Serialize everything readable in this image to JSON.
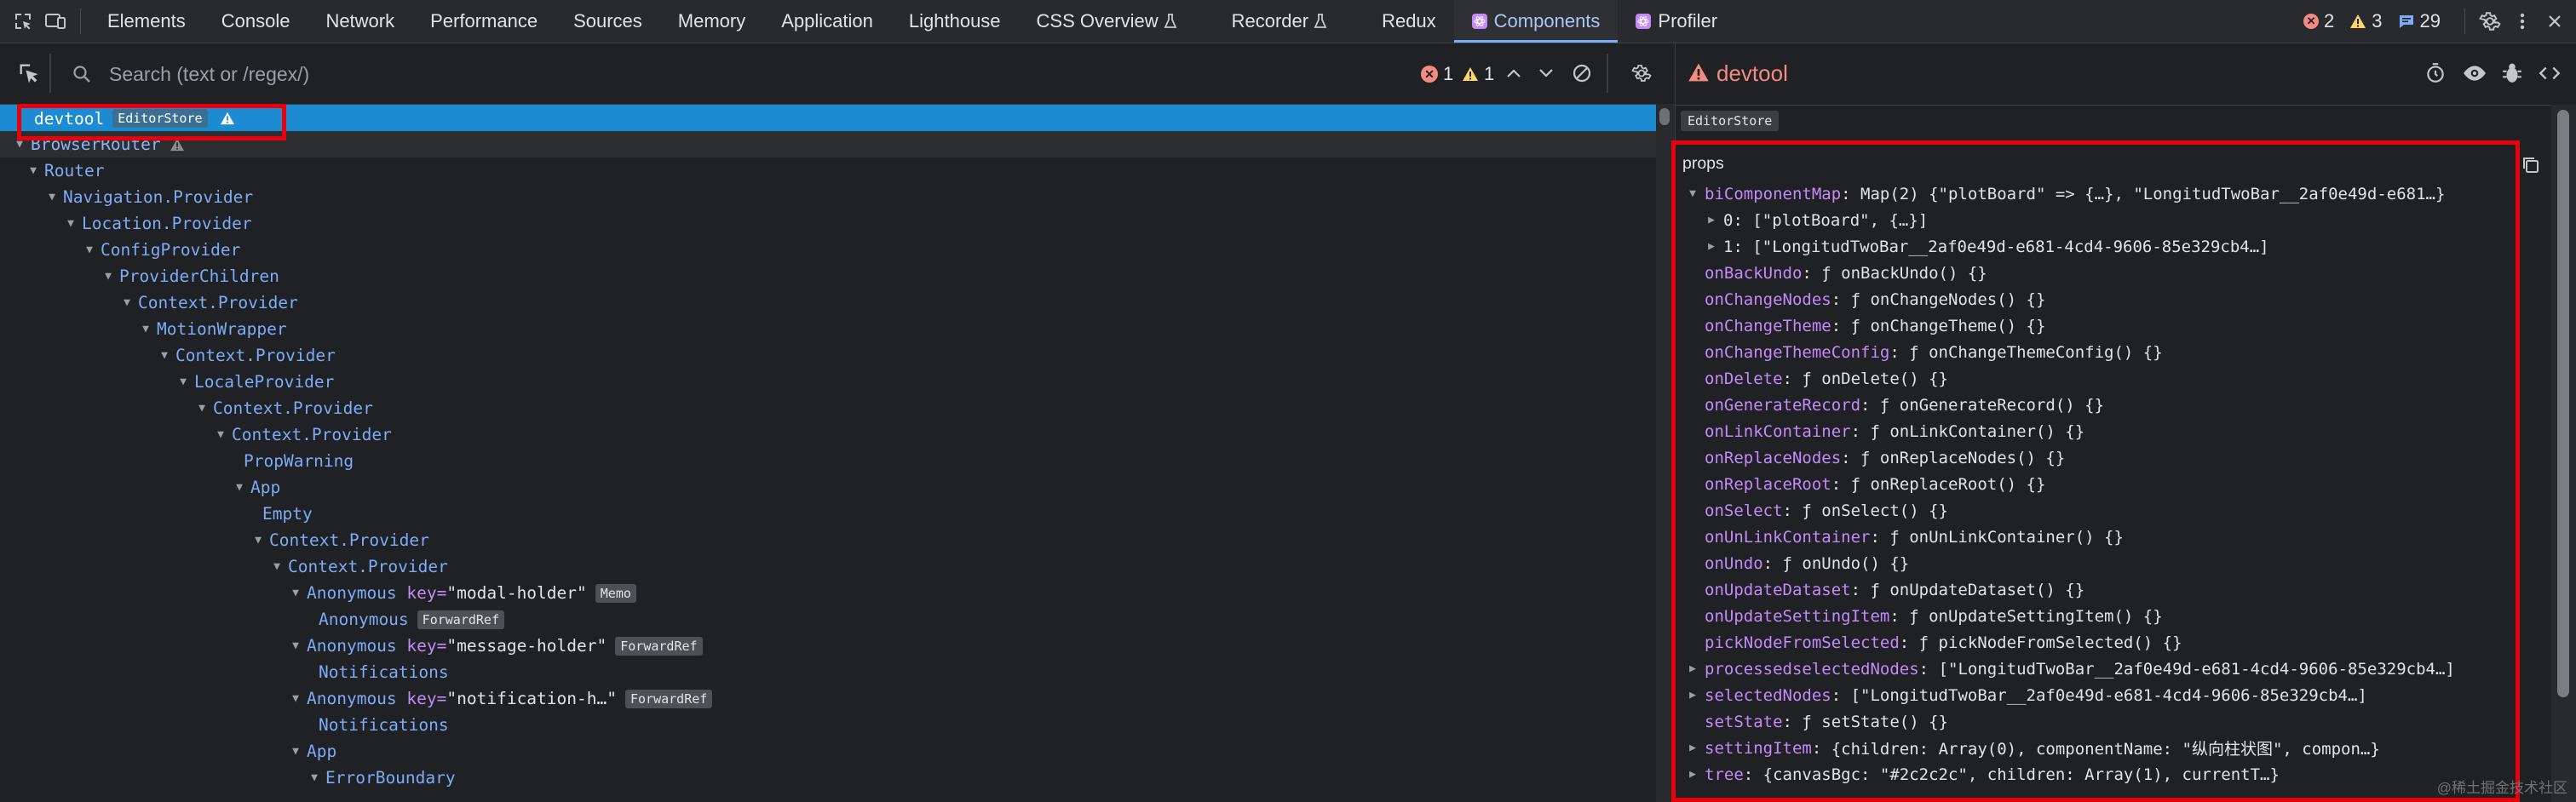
{
  "tabs": [
    {
      "label": "Elements"
    },
    {
      "label": "Console"
    },
    {
      "label": "Network"
    },
    {
      "label": "Performance"
    },
    {
      "label": "Sources"
    },
    {
      "label": "Memory"
    },
    {
      "label": "Application"
    },
    {
      "label": "Lighthouse"
    },
    {
      "label": "CSS Overview"
    },
    {
      "label": "Recorder"
    },
    {
      "label": "Redux"
    },
    {
      "label": "Components"
    },
    {
      "label": "Profiler"
    }
  ],
  "counts": {
    "errors": "2",
    "warnings": "3",
    "messages": "29"
  },
  "search": {
    "placeholder": "Search (text or /regex/)"
  },
  "search_status": {
    "errors": "1",
    "warnings": "1"
  },
  "tree": [
    {
      "name": "devtool",
      "badges": [
        "EditorStore"
      ],
      "warn": true,
      "selected": true
    },
    {
      "name": "BrowserRouter",
      "warn": true
    },
    {
      "name": "Router"
    },
    {
      "name": "Navigation.Provider"
    },
    {
      "name": "Location.Provider"
    },
    {
      "name": "ConfigProvider"
    },
    {
      "name": "ProviderChildren"
    },
    {
      "name": "Context.Provider"
    },
    {
      "name": "MotionWrapper"
    },
    {
      "name": "Context.Provider"
    },
    {
      "name": "LocaleProvider"
    },
    {
      "name": "Context.Provider"
    },
    {
      "name": "Context.Provider"
    },
    {
      "name": "PropWarning"
    },
    {
      "name": "App"
    },
    {
      "name": "Empty"
    },
    {
      "name": "Context.Provider"
    },
    {
      "name": "Context.Provider"
    },
    {
      "name": "Anonymous",
      "key": "\"modal-holder\"",
      "badges": [
        "Memo"
      ]
    },
    {
      "name": "Anonymous",
      "badges": [
        "ForwardRef"
      ]
    },
    {
      "name": "Anonymous",
      "key": "\"message-holder\"",
      "badges": [
        "ForwardRef"
      ]
    },
    {
      "name": "Notifications"
    },
    {
      "name": "Anonymous",
      "key": "\"notification-h…\"",
      "badges": [
        "ForwardRef"
      ]
    },
    {
      "name": "Notifications"
    },
    {
      "name": "App"
    },
    {
      "name": "ErrorBoundary"
    }
  ],
  "right": {
    "component_name": "devtool",
    "store_badge": "EditorStore",
    "props_title": "props",
    "props": [
      {
        "key": "biComponentMap",
        "value": "Map(2) {\"plotBoard\" => {…}, \"LongitudTwoBar__2af0e49d-e681…}"
      },
      {
        "key": "0",
        "value": "[\"plotBoard\", {…}]"
      },
      {
        "key": "1",
        "value": "[\"LongitudTwoBar__2af0e49d-e681-4cd4-9606-85e329cb4…]"
      },
      {
        "key": "onBackUndo",
        "value": "ƒ onBackUndo() {}"
      },
      {
        "key": "onChangeNodes",
        "value": "ƒ onChangeNodes() {}"
      },
      {
        "key": "onChangeTheme",
        "value": "ƒ onChangeTheme() {}"
      },
      {
        "key": "onChangeThemeConfig",
        "value": "ƒ onChangeThemeConfig() {}"
      },
      {
        "key": "onDelete",
        "value": "ƒ onDelete() {}"
      },
      {
        "key": "onGenerateRecord",
        "value": "ƒ onGenerateRecord() {}"
      },
      {
        "key": "onLinkContainer",
        "value": "ƒ onLinkContainer() {}"
      },
      {
        "key": "onReplaceNodes",
        "value": "ƒ onReplaceNodes() {}"
      },
      {
        "key": "onReplaceRoot",
        "value": "ƒ onReplaceRoot() {}"
      },
      {
        "key": "onSelect",
        "value": "ƒ onSelect() {}"
      },
      {
        "key": "onUnLinkContainer",
        "value": "ƒ onUnLinkContainer() {}"
      },
      {
        "key": "onUndo",
        "value": "ƒ onUndo() {}"
      },
      {
        "key": "onUpdateDataset",
        "value": "ƒ onUpdateDataset() {}"
      },
      {
        "key": "onUpdateSettingItem",
        "value": "ƒ onUpdateSettingItem() {}"
      },
      {
        "key": "pickNodeFromSelected",
        "value": "ƒ pickNodeFromSelected() {}"
      },
      {
        "key": "processedselectedNodes",
        "value": "[\"LongitudTwoBar__2af0e49d-e681-4cd4-9606-85e329cb4…]"
      },
      {
        "key": "selectedNodes",
        "value": "[\"LongitudTwoBar__2af0e49d-e681-4cd4-9606-85e329cb4…]"
      },
      {
        "key": "setState",
        "value": "ƒ setState() {}"
      },
      {
        "key": "settingItem",
        "value": "{children: Array(0), componentName: \"纵向柱状图\", compon…}"
      },
      {
        "key": "tree",
        "value": "{canvasBgc: \"#2c2c2c\", children: Array(1), currentT…}"
      }
    ]
  },
  "watermark": "@稀土掘金技术社区",
  "colors": {
    "accent": "#7cacf8",
    "selected_row": "#1d8bd1",
    "error": "#f28b82",
    "highlight_box": "#e8000b"
  }
}
